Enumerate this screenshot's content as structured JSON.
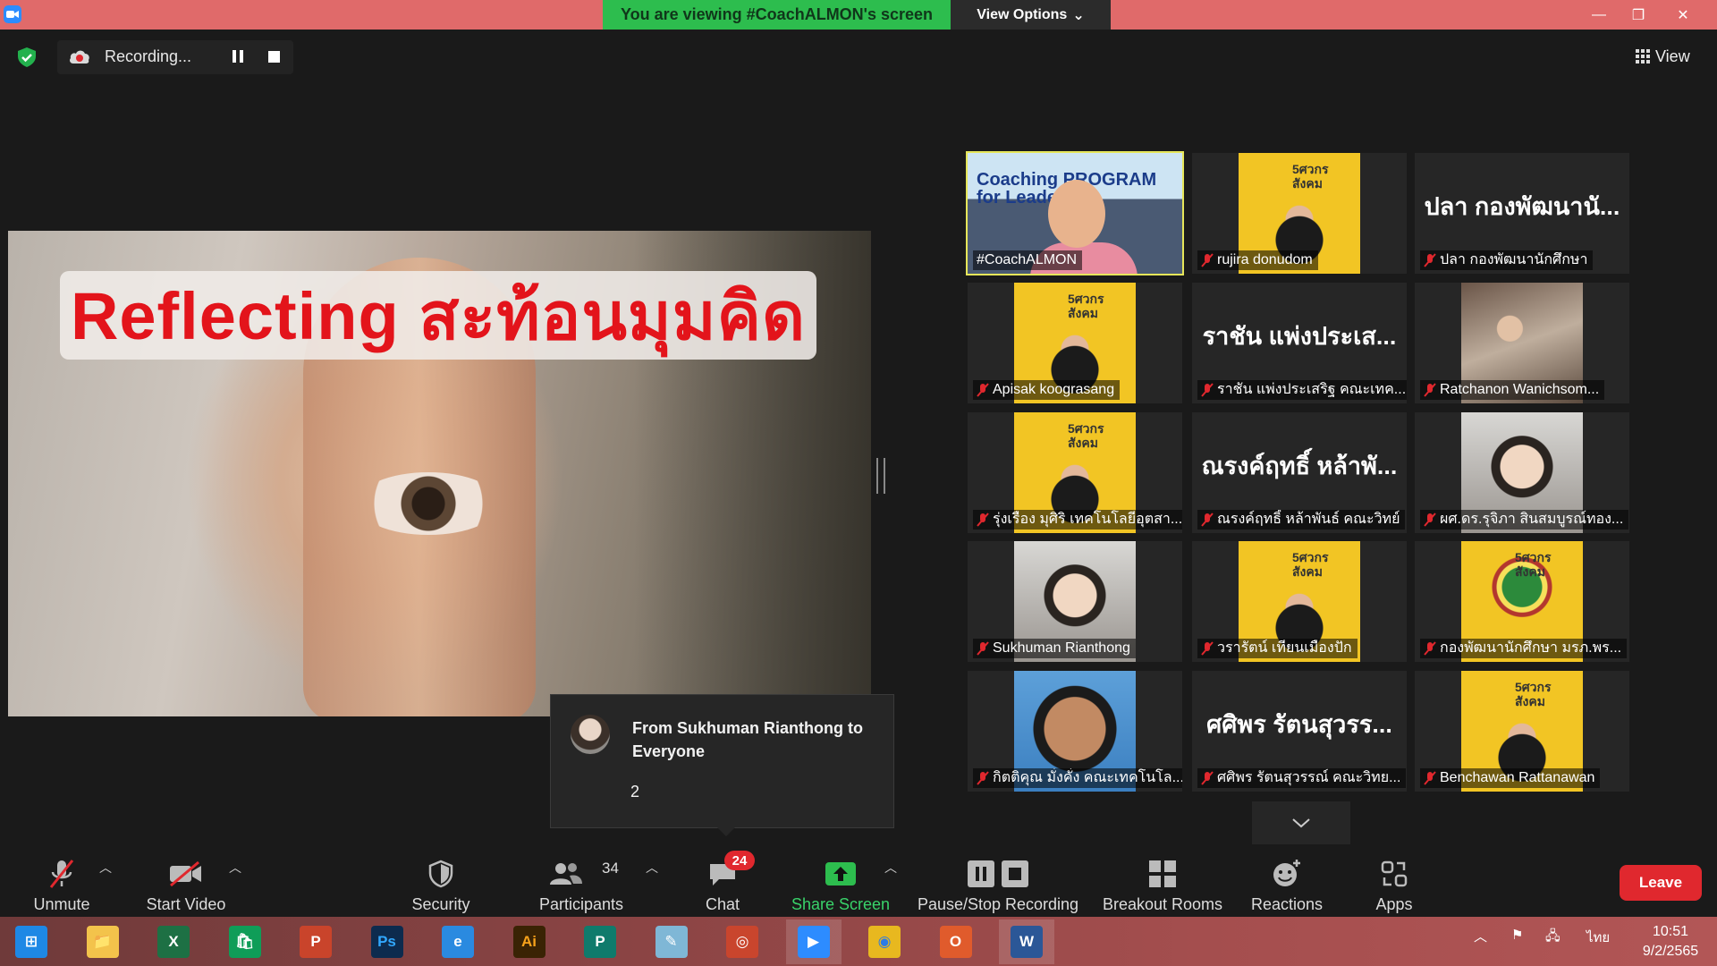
{
  "titlebar": {
    "viewing_banner": "You are viewing #CoachALMON's screen",
    "view_options": "View Options",
    "minimize": "—",
    "restore": "❐",
    "close": "✕"
  },
  "recording": {
    "status": "Recording...",
    "view_label": "View"
  },
  "share": {
    "title": "Reflecting สะท้อนมุมคิด"
  },
  "chat_popup": {
    "from": "From Sukhuman Rianthong to Everyone",
    "message": "2"
  },
  "gallery": [
    {
      "name": "#CoachALMON",
      "type": "coach",
      "active": true,
      "muted": false
    },
    {
      "name": "rujira donudom",
      "type": "yellow-person",
      "muted": true
    },
    {
      "name": "ปลา กองพัฒนานักศึกษา",
      "type": "name-only",
      "big": "ปลา กองพัฒนานั...",
      "muted": true
    },
    {
      "name": "Apisak koograsang",
      "type": "yellow-person",
      "muted": true
    },
    {
      "name": "ราชัน แพ่งประเสริฐ คณะเทค...",
      "type": "name-only",
      "big": "ราชัน แพ่งประเส...",
      "muted": true
    },
    {
      "name": "Ratchanon Wanichsom...",
      "type": "food",
      "muted": true
    },
    {
      "name": "รุ่งเรือง มุศิริ เทคโนโลยีอุตสา...",
      "type": "yellow-person",
      "muted": true
    },
    {
      "name": "ณรงค์ฤทธิ์ หล้าพันธ์ คณะวิทย์",
      "type": "name-only",
      "big": "ณรงค์ฤทธิ์ หล้าพั...",
      "muted": true
    },
    {
      "name": "ผศ.ดร.รุจิภา สินสมบูรณ์ทอง...",
      "type": "light",
      "muted": true
    },
    {
      "name": "Sukhuman Rianthong",
      "type": "light",
      "muted": true
    },
    {
      "name": "วรารัตน์ เทียนเมืองปัก",
      "type": "yellow-person",
      "muted": true
    },
    {
      "name": "กองพัฒนานักศึกษา มรภ.พร...",
      "type": "seal",
      "muted": true
    },
    {
      "name": "กิตติคุณ มั่งคั่ง คณะเทคโนโล...",
      "type": "cartoon",
      "muted": true
    },
    {
      "name": "ศศิพร รัตนสุวรรณ์ คณะวิทย...",
      "type": "name-only",
      "big": "ศศิพร รัตนสุวรร...",
      "muted": true
    },
    {
      "name": "Benchawan Rattanawan",
      "type": "yellow-person",
      "muted": true
    }
  ],
  "coach_screen_text": "Coaching PROGRAM for Leader",
  "toolbar": {
    "unmute": "Unmute",
    "start_video": "Start Video",
    "security": "Security",
    "participants": "Participants",
    "participants_count": "34",
    "chat": "Chat",
    "chat_badge": "24",
    "share_screen": "Share Screen",
    "pause_stop_recording": "Pause/Stop Recording",
    "breakout_rooms": "Breakout Rooms",
    "reactions": "Reactions",
    "apps": "Apps",
    "leave": "Leave"
  },
  "taskbar": {
    "apps": [
      "windows-start",
      "file-explorer",
      "excel",
      "store",
      "powerpoint",
      "photoshop",
      "internet-explorer",
      "illustrator",
      "publisher",
      "notepad",
      "photoscape",
      "zoom",
      "chrome",
      "office",
      "word"
    ],
    "language": "ไทย",
    "time": "10:51",
    "date": "9/2/2565"
  },
  "colors": {
    "titlebar": "#e06a6a",
    "banner_green": "#2dbd4e",
    "leave_red": "#e0282e",
    "share_green": "#2dbd4e",
    "active_tile": "#e6e65a",
    "tile_yellow": "#f2c524"
  }
}
